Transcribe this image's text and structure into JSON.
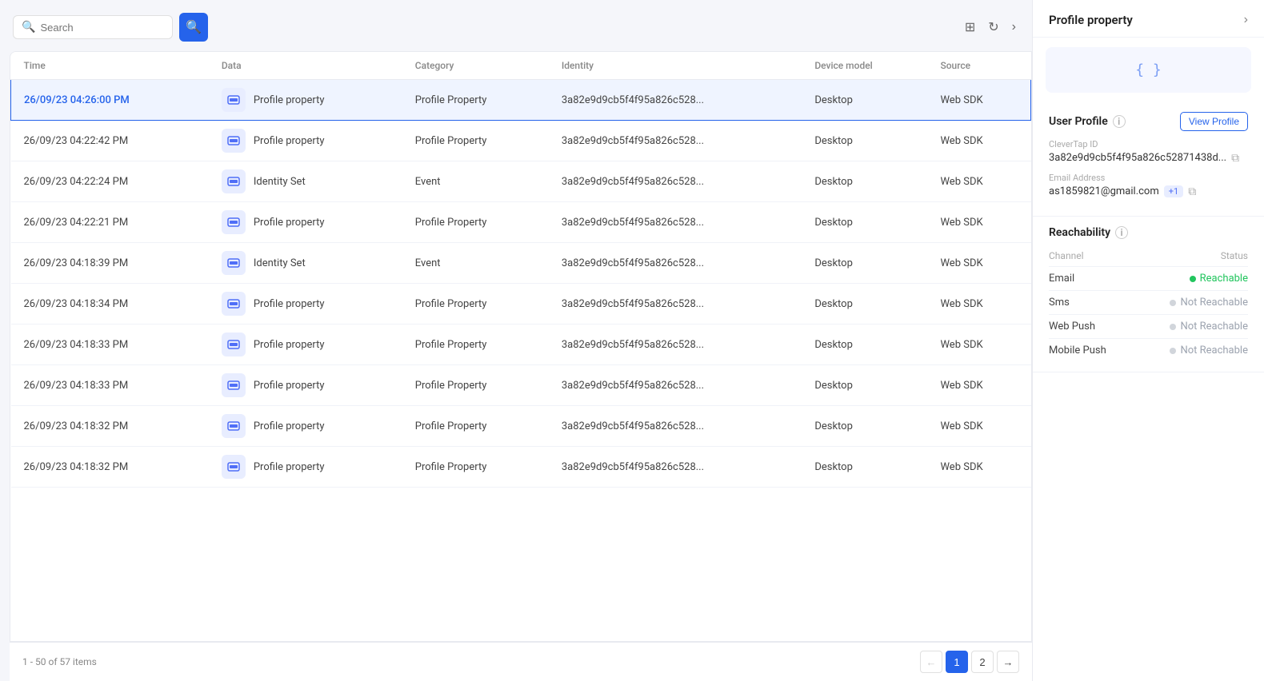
{
  "toolbar": {
    "search_placeholder": "Search",
    "search_btn_icon": "🔍"
  },
  "table": {
    "columns": [
      "Time",
      "Data",
      "Category",
      "Identity",
      "Device model",
      "Source"
    ],
    "rows": [
      {
        "time": "26/09/23 04:26:00 PM",
        "data": "Profile property",
        "category": "Profile Property",
        "identity": "3a82e9d9cb5f4f95a826c528...",
        "device": "Desktop",
        "source": "Web SDK",
        "selected": true
      },
      {
        "time": "26/09/23 04:22:42 PM",
        "data": "Profile property",
        "category": "Profile Property",
        "identity": "3a82e9d9cb5f4f95a826c528...",
        "device": "Desktop",
        "source": "Web SDK",
        "selected": false
      },
      {
        "time": "26/09/23 04:22:24 PM",
        "data": "Identity Set",
        "category": "Event",
        "identity": "3a82e9d9cb5f4f95a826c528...",
        "device": "Desktop",
        "source": "Web SDK",
        "selected": false
      },
      {
        "time": "26/09/23 04:22:21 PM",
        "data": "Profile property",
        "category": "Profile Property",
        "identity": "3a82e9d9cb5f4f95a826c528...",
        "device": "Desktop",
        "source": "Web SDK",
        "selected": false
      },
      {
        "time": "26/09/23 04:18:39 PM",
        "data": "Identity Set",
        "category": "Event",
        "identity": "3a82e9d9cb5f4f95a826c528...",
        "device": "Desktop",
        "source": "Web SDK",
        "selected": false
      },
      {
        "time": "26/09/23 04:18:34 PM",
        "data": "Profile property",
        "category": "Profile Property",
        "identity": "3a82e9d9cb5f4f95a826c528...",
        "device": "Desktop",
        "source": "Web SDK",
        "selected": false
      },
      {
        "time": "26/09/23 04:18:33 PM",
        "data": "Profile property",
        "category": "Profile Property",
        "identity": "3a82e9d9cb5f4f95a826c528...",
        "device": "Desktop",
        "source": "Web SDK",
        "selected": false
      },
      {
        "time": "26/09/23 04:18:33 PM",
        "data": "Profile property",
        "category": "Profile Property",
        "identity": "3a82e9d9cb5f4f95a826c528...",
        "device": "Desktop",
        "source": "Web SDK",
        "selected": false
      },
      {
        "time": "26/09/23 04:18:32 PM",
        "data": "Profile property",
        "category": "Profile Property",
        "identity": "3a82e9d9cb5f4f95a826c528...",
        "device": "Desktop",
        "source": "Web SDK",
        "selected": false
      },
      {
        "time": "26/09/23 04:18:32 PM",
        "data": "Profile property",
        "category": "Profile Property",
        "identity": "3a82e9d9cb5f4f95a826c528...",
        "device": "Desktop",
        "source": "Web SDK",
        "selected": false
      }
    ],
    "pagination": {
      "info": "1 - 50 of 57 items",
      "current_page": 1,
      "total_pages": 2,
      "prev_icon": "←",
      "next_icon": "→"
    }
  },
  "right_panel": {
    "title": "Profile property",
    "expand_icon": "›",
    "code_preview": "{ }",
    "user_profile": {
      "title": "User Profile",
      "view_profile_label": "View Profile",
      "clevertap_id_label": "CleverTap ID",
      "clevertap_id_value": "3a82e9d9cb5f4f95a826c52871438d...",
      "email_label": "Email Address",
      "email_value": "as1859821@gmail.com",
      "email_badge": "+1"
    },
    "reachability": {
      "title": "Reachability",
      "channel_header": "Channel",
      "status_header": "Status",
      "channels": [
        {
          "name": "Email",
          "status": "Reachable",
          "reachable": true
        },
        {
          "name": "Sms",
          "status": "Not Reachable",
          "reachable": false
        },
        {
          "name": "Web Push",
          "status": "Not Reachable",
          "reachable": false
        },
        {
          "name": "Mobile Push",
          "status": "Not Reachable",
          "reachable": false
        }
      ]
    }
  }
}
